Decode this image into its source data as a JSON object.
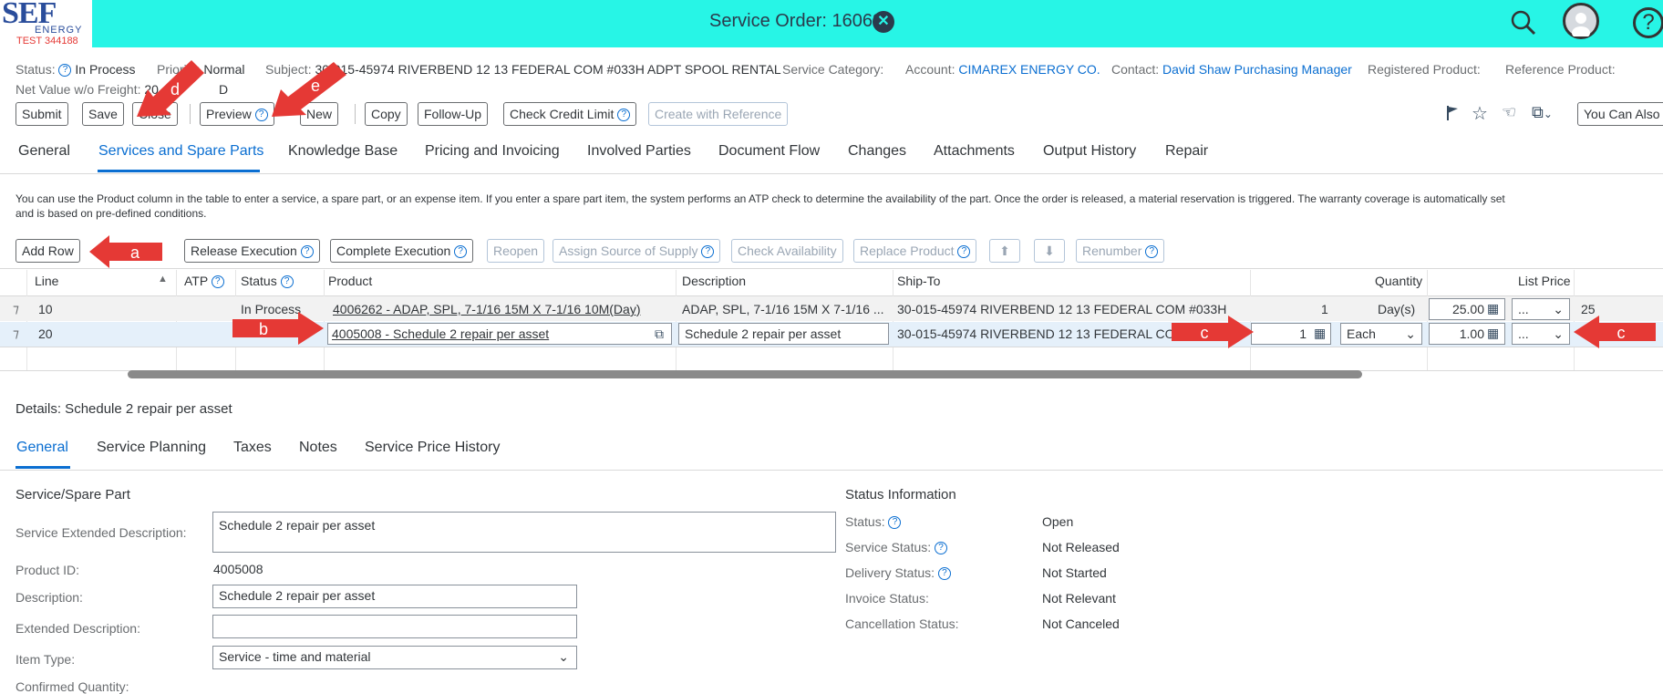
{
  "shell": {
    "logo_text": "SEF",
    "logo_sub": "ENERGY",
    "logo_test": "TEST 344188",
    "title": "Service Order: 16063"
  },
  "header": {
    "status_label": "Status:",
    "status_value": "In Process",
    "priority_label": "Priority:",
    "priority_value": "Normal",
    "subject_label": "Subject:",
    "subject_value": "30-015-45974 RIVERBEND 12 13 FEDERAL COM #033H ADPT SPOOL RENTAL",
    "service_category_label": "Service Category:",
    "account_label": "Account:",
    "account_value": "CIMAREX ENERGY CO.",
    "contact_label": "Contact:",
    "contact_value": "David Shaw Purchasing Manager",
    "registered_product_label": "Registered Product:",
    "reference_product_label": "Reference Product:",
    "net_value_label": "Net Value w/o Freight:",
    "net_value_value": "20",
    "net_value_currency": "D"
  },
  "toolbar": {
    "submit": "Submit",
    "save": "Save",
    "close": "Close",
    "preview": "Preview",
    "new": "New",
    "copy": "Copy",
    "follow_up": "Follow-Up",
    "check_credit_limit": "Check Credit Limit",
    "create_with_reference": "Create with Reference",
    "you_can_also": "You Can Also"
  },
  "tabs": [
    {
      "label": "General"
    },
    {
      "label": "Services and Spare Parts"
    },
    {
      "label": "Knowledge Base"
    },
    {
      "label": "Pricing and Invoicing"
    },
    {
      "label": "Involved Parties"
    },
    {
      "label": "Document Flow"
    },
    {
      "label": "Changes"
    },
    {
      "label": "Attachments"
    },
    {
      "label": "Output History"
    },
    {
      "label": "Repair"
    }
  ],
  "info_text": {
    "line1": "You can use the Product column in the table to enter a service, a spare part, or an expense item. If you enter a spare part item, the system performs an ATP check to determine the availability of the part. Once the order is released, a material reservation is triggered. The warranty coverage is automatically set",
    "line2": "and is based on pre-defined conditions."
  },
  "table_toolbar": {
    "add_row": "Add Row",
    "release_execution": "Release Execution",
    "complete_execution": "Complete Execution",
    "reopen": "Reopen",
    "assign_source": "Assign Source of Supply",
    "check_availability": "Check Availability",
    "replace_product": "Replace Product",
    "renumber": "Renumber"
  },
  "table": {
    "columns": {
      "line": "Line",
      "atp": "ATP",
      "status": "Status",
      "product": "Product",
      "description": "Description",
      "ship_to": "Ship-To",
      "quantity": "Quantity",
      "list_price": "List Price"
    },
    "rows": [
      {
        "line": "10",
        "status": "In Process",
        "product": "4006262 - ADAP, SPL, 7-1/16 15M X 7-1/16 10M(Day)",
        "description": "ADAP, SPL, 7-1/16 15M X 7-1/16 ...",
        "ship_to": "30-015-45974 RIVERBEND 12 13 FEDERAL COM #033H",
        "quantity": "1",
        "unit": "Day(s)",
        "price": "25.00",
        "currency": "...",
        "extra": "25"
      },
      {
        "line": "20",
        "status": "",
        "product": "4005008 - Schedule 2 repair per asset",
        "description": "Schedule 2 repair per asset",
        "ship_to": "30-015-45974 RIVERBEND 12 13 FEDERAL COM",
        "quantity": "1",
        "unit": "Each",
        "price": "1.00",
        "currency": "..."
      }
    ]
  },
  "details": {
    "title": "Details: Schedule 2 repair per asset",
    "tabs": [
      {
        "label": "General"
      },
      {
        "label": "Service Planning"
      },
      {
        "label": "Taxes"
      },
      {
        "label": "Notes"
      },
      {
        "label": "Service Price History"
      }
    ],
    "left_section_title": "Service/Spare Part",
    "service_ext_desc_label": "Service Extended Description:",
    "service_ext_desc_value": "Schedule 2 repair per asset",
    "product_id_label": "Product ID:",
    "product_id_value": "4005008",
    "description_label": "Description:",
    "description_value": "Schedule 2 repair per asset",
    "extended_description_label": "Extended Description:",
    "extended_description_value": "",
    "item_type_label": "Item Type:",
    "item_type_value": "Service - time and material",
    "confirmed_quantity_label": "Confirmed Quantity:",
    "right_section_title": "Status Information",
    "status_rows": [
      {
        "label": "Status:",
        "value": "Open"
      },
      {
        "label": "Service Status:",
        "value": "Not Released"
      },
      {
        "label": "Delivery Status:",
        "value": "Not Started"
      },
      {
        "label": "Invoice Status:",
        "value": "Not Relevant"
      },
      {
        "label": "Cancellation Status:",
        "value": "Not Canceled"
      }
    ]
  },
  "annotations": {
    "a": "a",
    "b": "b",
    "c1": "c",
    "c2": "c",
    "d": "d",
    "e": "e",
    "arrow_color": "#e53935"
  },
  "colors": {
    "shell_bg": "#27f5e6",
    "accent": "#0a6ed1"
  }
}
